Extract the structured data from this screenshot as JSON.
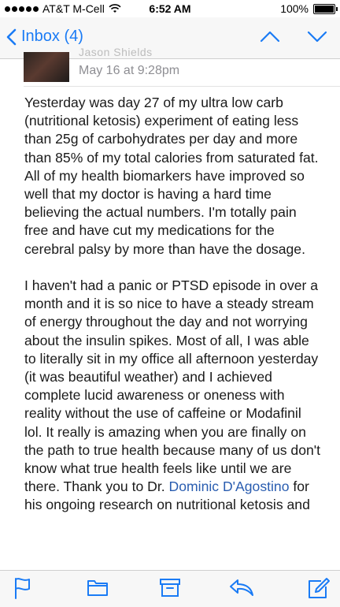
{
  "status_bar": {
    "carrier": "AT&T M-Cell",
    "time": "6:52 AM",
    "battery": "100%",
    "battery_level": 1.0,
    "signal_icon": "signal-dots-icon",
    "wifi_icon": "wifi-icon",
    "battery_icon": "battery-icon"
  },
  "nav": {
    "back_label": "Inbox (4)",
    "back_icon": "chevron-left-icon",
    "prev_icon": "chevron-up-icon",
    "next_icon": "chevron-down-icon",
    "accent_color": "#1a7bf5"
  },
  "message": {
    "sender_name": "Jason Shields",
    "date": "May 16 at 9:28pm",
    "paragraph_1": "Yesterday was day 27 of my ultra low carb (nutritional ketosis) experiment of eating less than 25g of carbohydrates per day and more than 85% of my total calories from saturated fat. All of my health biomarkers have improved so well that my doctor is having a hard time believing the actual numbers. I'm totally pain free and have cut my medications for the cerebral palsy by more than have the dosage.",
    "paragraph_2_before_link": "I haven't had a panic or PTSD episode in over a month and it is so nice to have a steady stream of energy throughout the day and not worrying about the insulin spikes. Most of all, I was able to literally sit in my office all afternoon yesterday (it was beautiful weather) and I achieved complete lucid awareness or oneness with reality without the use of caffeine or Modafinil lol. It really is amazing when you are finally on the path to true health because many of us don't know what true health feels like until we are there. Thank you to Dr. ",
    "link_text": "Dominic D'Agostino",
    "paragraph_2_after_link": " for his ongoing research on nutritional ketosis and"
  },
  "toolbar": {
    "icons": [
      "flag-icon",
      "folder-icon",
      "archive-icon",
      "reply-icon",
      "compose-icon"
    ],
    "color": "#1a7bf5"
  }
}
